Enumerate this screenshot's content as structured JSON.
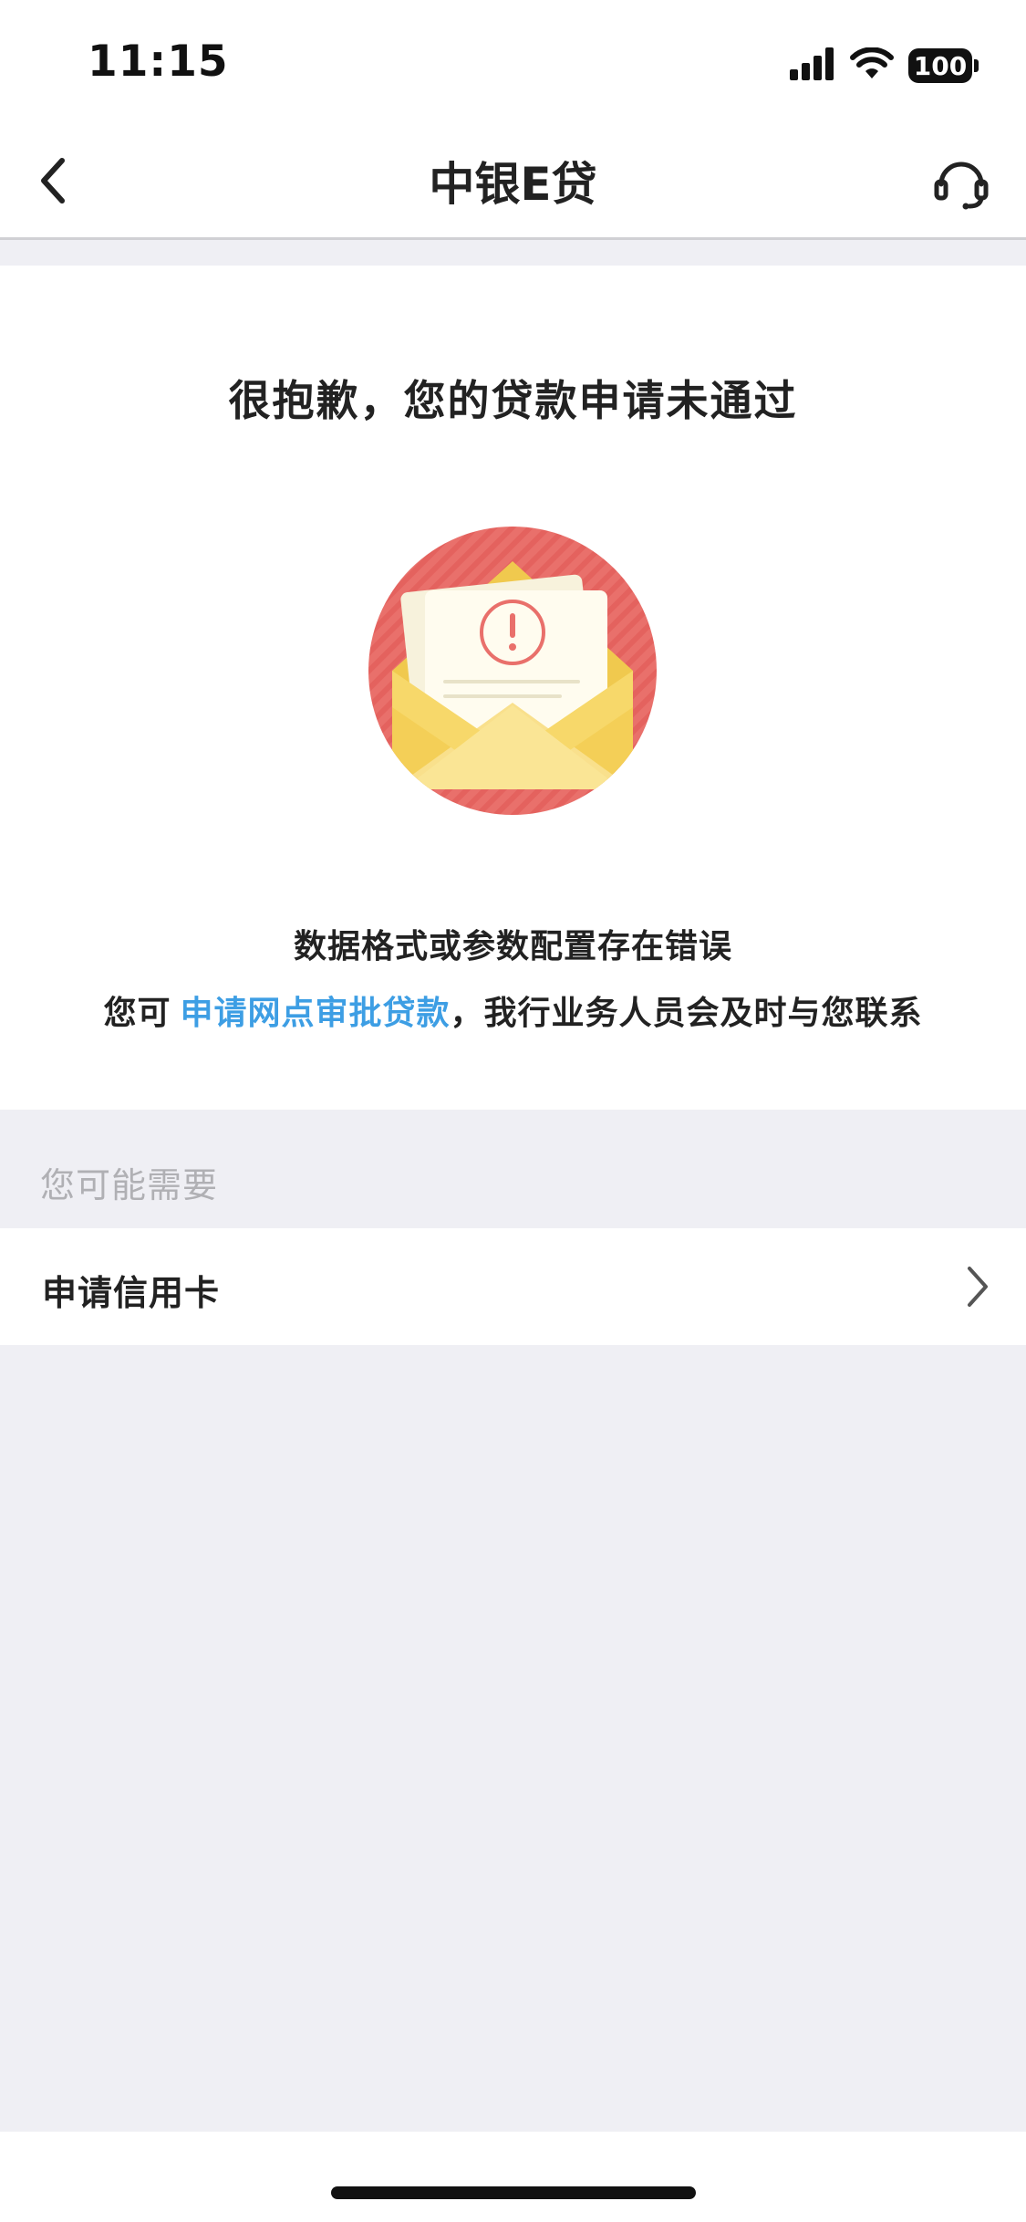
{
  "status_bar": {
    "time": "11:15",
    "battery_level": "100",
    "icons": [
      "signal-icon",
      "wifi-icon",
      "battery-icon"
    ]
  },
  "nav": {
    "title": "中银E贷",
    "back_icon": "chevron-left-icon",
    "service_icon": "headset-icon"
  },
  "result": {
    "title": "很抱歉，您的贷款申请未通过",
    "illustration_icon": "envelope-alert-icon",
    "error_message": "数据格式或参数配置存在错误",
    "contact_prefix": "您可",
    "contact_link": "申请网点审批贷款",
    "contact_suffix": "，我行业务人员会及时与您联系"
  },
  "suggestions": {
    "header": "您可能需要",
    "items": [
      {
        "label": "申请信用卡",
        "icon": "chevron-right-icon"
      }
    ]
  },
  "colors": {
    "link": "#3d9ee4",
    "page_background": "#efeff4",
    "illustration_circle": "#e9706b",
    "envelope": "#f7d86a"
  }
}
